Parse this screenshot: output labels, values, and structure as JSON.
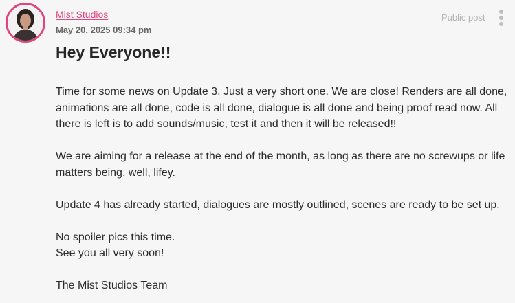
{
  "post": {
    "author": "Mist Studios",
    "timestamp": "May 20, 2025 09:34 pm",
    "visibility": "Public post",
    "title": "Hey Everyone!!",
    "paragraphs": [
      "Time for some news on Update 3. Just a very short one. We are close! Renders are all done, animations are all done, code is all done, dialogue is all done and being proof read now. All there is left is to add sounds/music, test it and then it will be released!!",
      "We are aiming for a release at the end of the month, as long as there are no screwups or life matters being, well, lifey.",
      "Update 4 has already started, dialogues are mostly outlined, scenes are ready to be set up.",
      "No spoiler pics this time.",
      "See you all very soon!",
      "The Mist Studios Team"
    ]
  },
  "icons": {
    "avatar": "avatar",
    "menu": "more-vertical-icon"
  },
  "colors": {
    "accent": "#e0457f",
    "muted": "#b4b4b4"
  }
}
